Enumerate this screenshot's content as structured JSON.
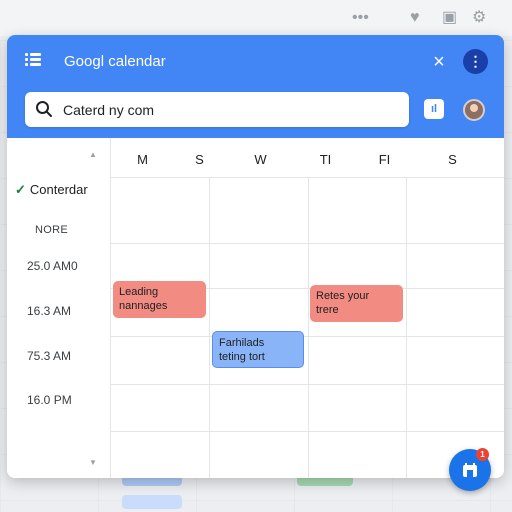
{
  "header": {
    "title": "Googl calendar",
    "close_icon": "×",
    "more_icon": "⋮",
    "square_label": "ıl"
  },
  "search": {
    "value": "Caterd ny com",
    "placeholder": "Caterd ny com"
  },
  "sidebar": {
    "scroll_up": "▲",
    "scroll_down": "▼",
    "calendar_check": "✓",
    "calendar_name": "Conterdar",
    "more_label": "NORE",
    "times": [
      "25.0 AM0",
      "16.3 AM",
      "75.3 AM",
      "16.0 PM"
    ]
  },
  "grid": {
    "days": [
      "M",
      "S",
      "W",
      "TI",
      "FI",
      "S"
    ]
  },
  "events": [
    {
      "line1": "Leading",
      "line2": "nannages",
      "color": "#f28b82"
    },
    {
      "line1": "Retes your",
      "line2": "trere",
      "color": "#f28b82"
    },
    {
      "line1": "Farhilads",
      "line2": "teting tort",
      "color": "#8ab4f8"
    }
  ],
  "fab": {
    "badge": "1"
  },
  "colors": {
    "header": "#4285f4",
    "accent_dark": "#1a3fa8",
    "fab": "#1a73e8",
    "check": "#188038"
  }
}
